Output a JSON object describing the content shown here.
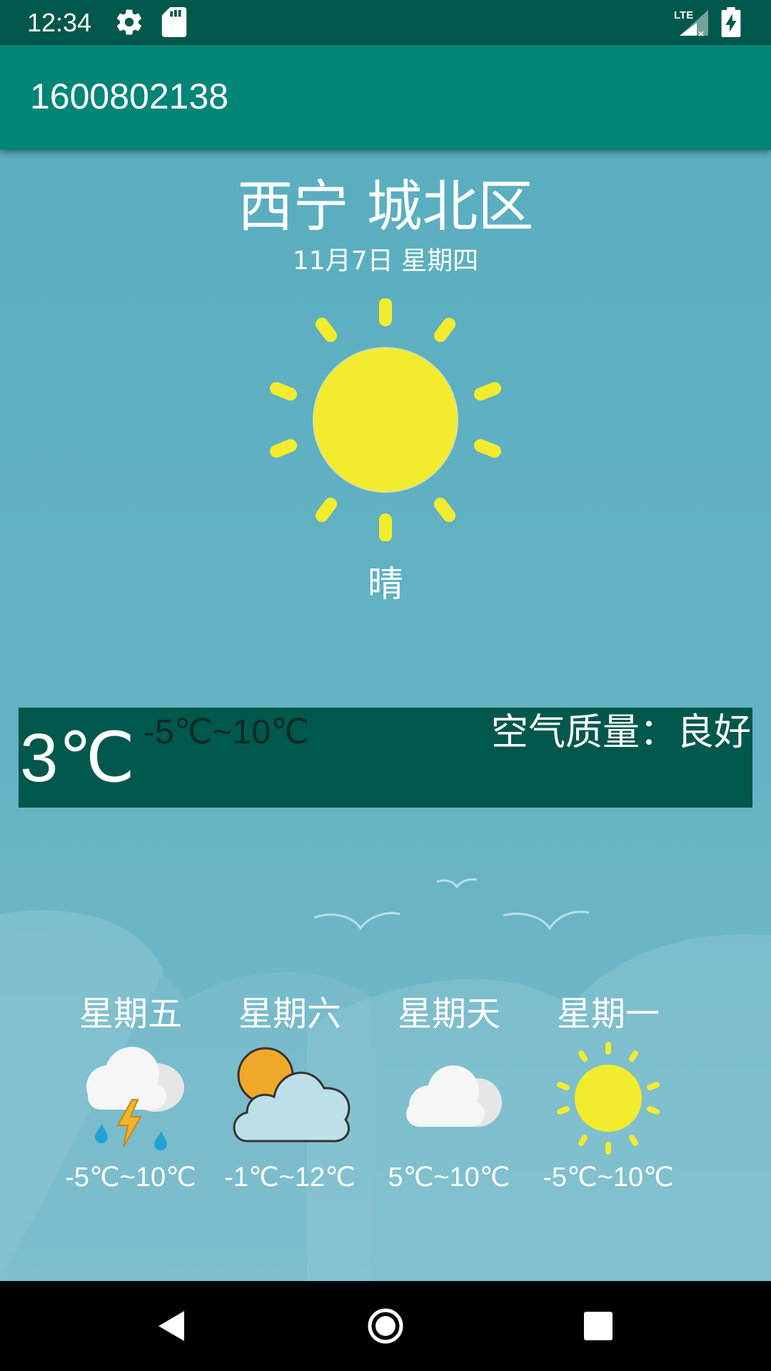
{
  "status_bar": {
    "time": "12:34",
    "icons": [
      "gear-icon",
      "sd-card-icon",
      "lte-signal-icon",
      "battery-charging-icon"
    ]
  },
  "app_bar": {
    "title": "1600802138"
  },
  "location": {
    "city": "西宁 城北区",
    "date": "11月7日 星期四"
  },
  "current": {
    "icon": "sun-icon",
    "condition": "晴",
    "temperature": "3℃",
    "range": "-5℃~10℃",
    "air_quality": "空气质量：良好"
  },
  "forecast": [
    {
      "day": "星期五",
      "icon": "thunderstorm-icon",
      "range": "-5℃~10℃"
    },
    {
      "day": "星期六",
      "icon": "partly-cloudy-icon",
      "range": "-1℃~12℃"
    },
    {
      "day": "星期天",
      "icon": "cloudy-icon",
      "range": "5℃~10℃"
    },
    {
      "day": "星期一",
      "icon": "sun-icon",
      "range": "-5℃~10℃"
    }
  ],
  "nav_bar": {
    "icons": [
      "back-icon",
      "home-icon",
      "recents-icon"
    ]
  },
  "colors": {
    "status_bar": "#00574b",
    "app_bar": "#008577",
    "panel": "#00574b",
    "sky": "#5aaec0",
    "sun": "#f3ec2e"
  }
}
